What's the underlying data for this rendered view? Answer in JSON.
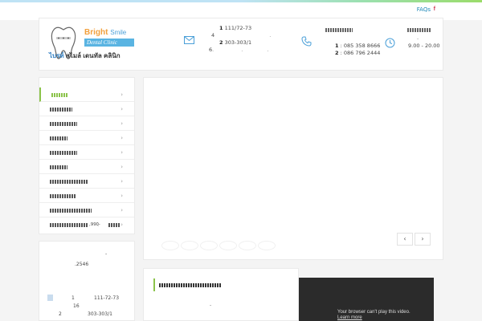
{
  "topbar": {
    "faqs_label": "FAQs",
    "facebook_label": "f"
  },
  "header": {
    "logo": {
      "bright": "Bright",
      "smile": "Smile",
      "dental_clinic": "Dental Clinic",
      "thai_name_1": "ไบรท์",
      "thai_name_2": "สไมล์ เดนทัล คลินิก"
    },
    "address": {
      "line1_num": "1",
      "line1_text": "111/72-73",
      "line2_num": "4",
      "line3_num": "2",
      "line3_text": "303-303/1",
      "line4_num": "6"
    },
    "phone": {
      "line1_num": "1",
      "line1_text": ": 085 358 8666",
      "line2_num": "2",
      "line2_text": ": 086 796 2444"
    },
    "hours": {
      "time": "9.00 - 20.00"
    }
  },
  "sidebar": {
    "items": [
      {
        "label": ""
      },
      {
        "label": ""
      },
      {
        "label": ""
      },
      {
        "label": ""
      },
      {
        "label": ""
      },
      {
        "label": ""
      },
      {
        "label": ""
      },
      {
        "label": ""
      },
      {
        "label": ""
      },
      {
        "label": ",990ฺ-"
      }
    ]
  },
  "slider": {
    "prev_label": "‹",
    "next_label": "›"
  },
  "contact_box": {
    "dash": "-",
    "year": ".2546",
    "addr1_num": "1",
    "addr1_text": "111-72-73",
    "addr1_sub": "16",
    "addr2_num": "2",
    "addr2_text": "303-303/1"
  },
  "video": {
    "message": "Your browser can't play this video.",
    "link": "Learn more"
  },
  "colors": {
    "accent_green": "#8bc34a",
    "brand_blue": "#1e88b8",
    "brand_orange": "#f2a03d",
    "facebook_red": "#d23b57"
  }
}
